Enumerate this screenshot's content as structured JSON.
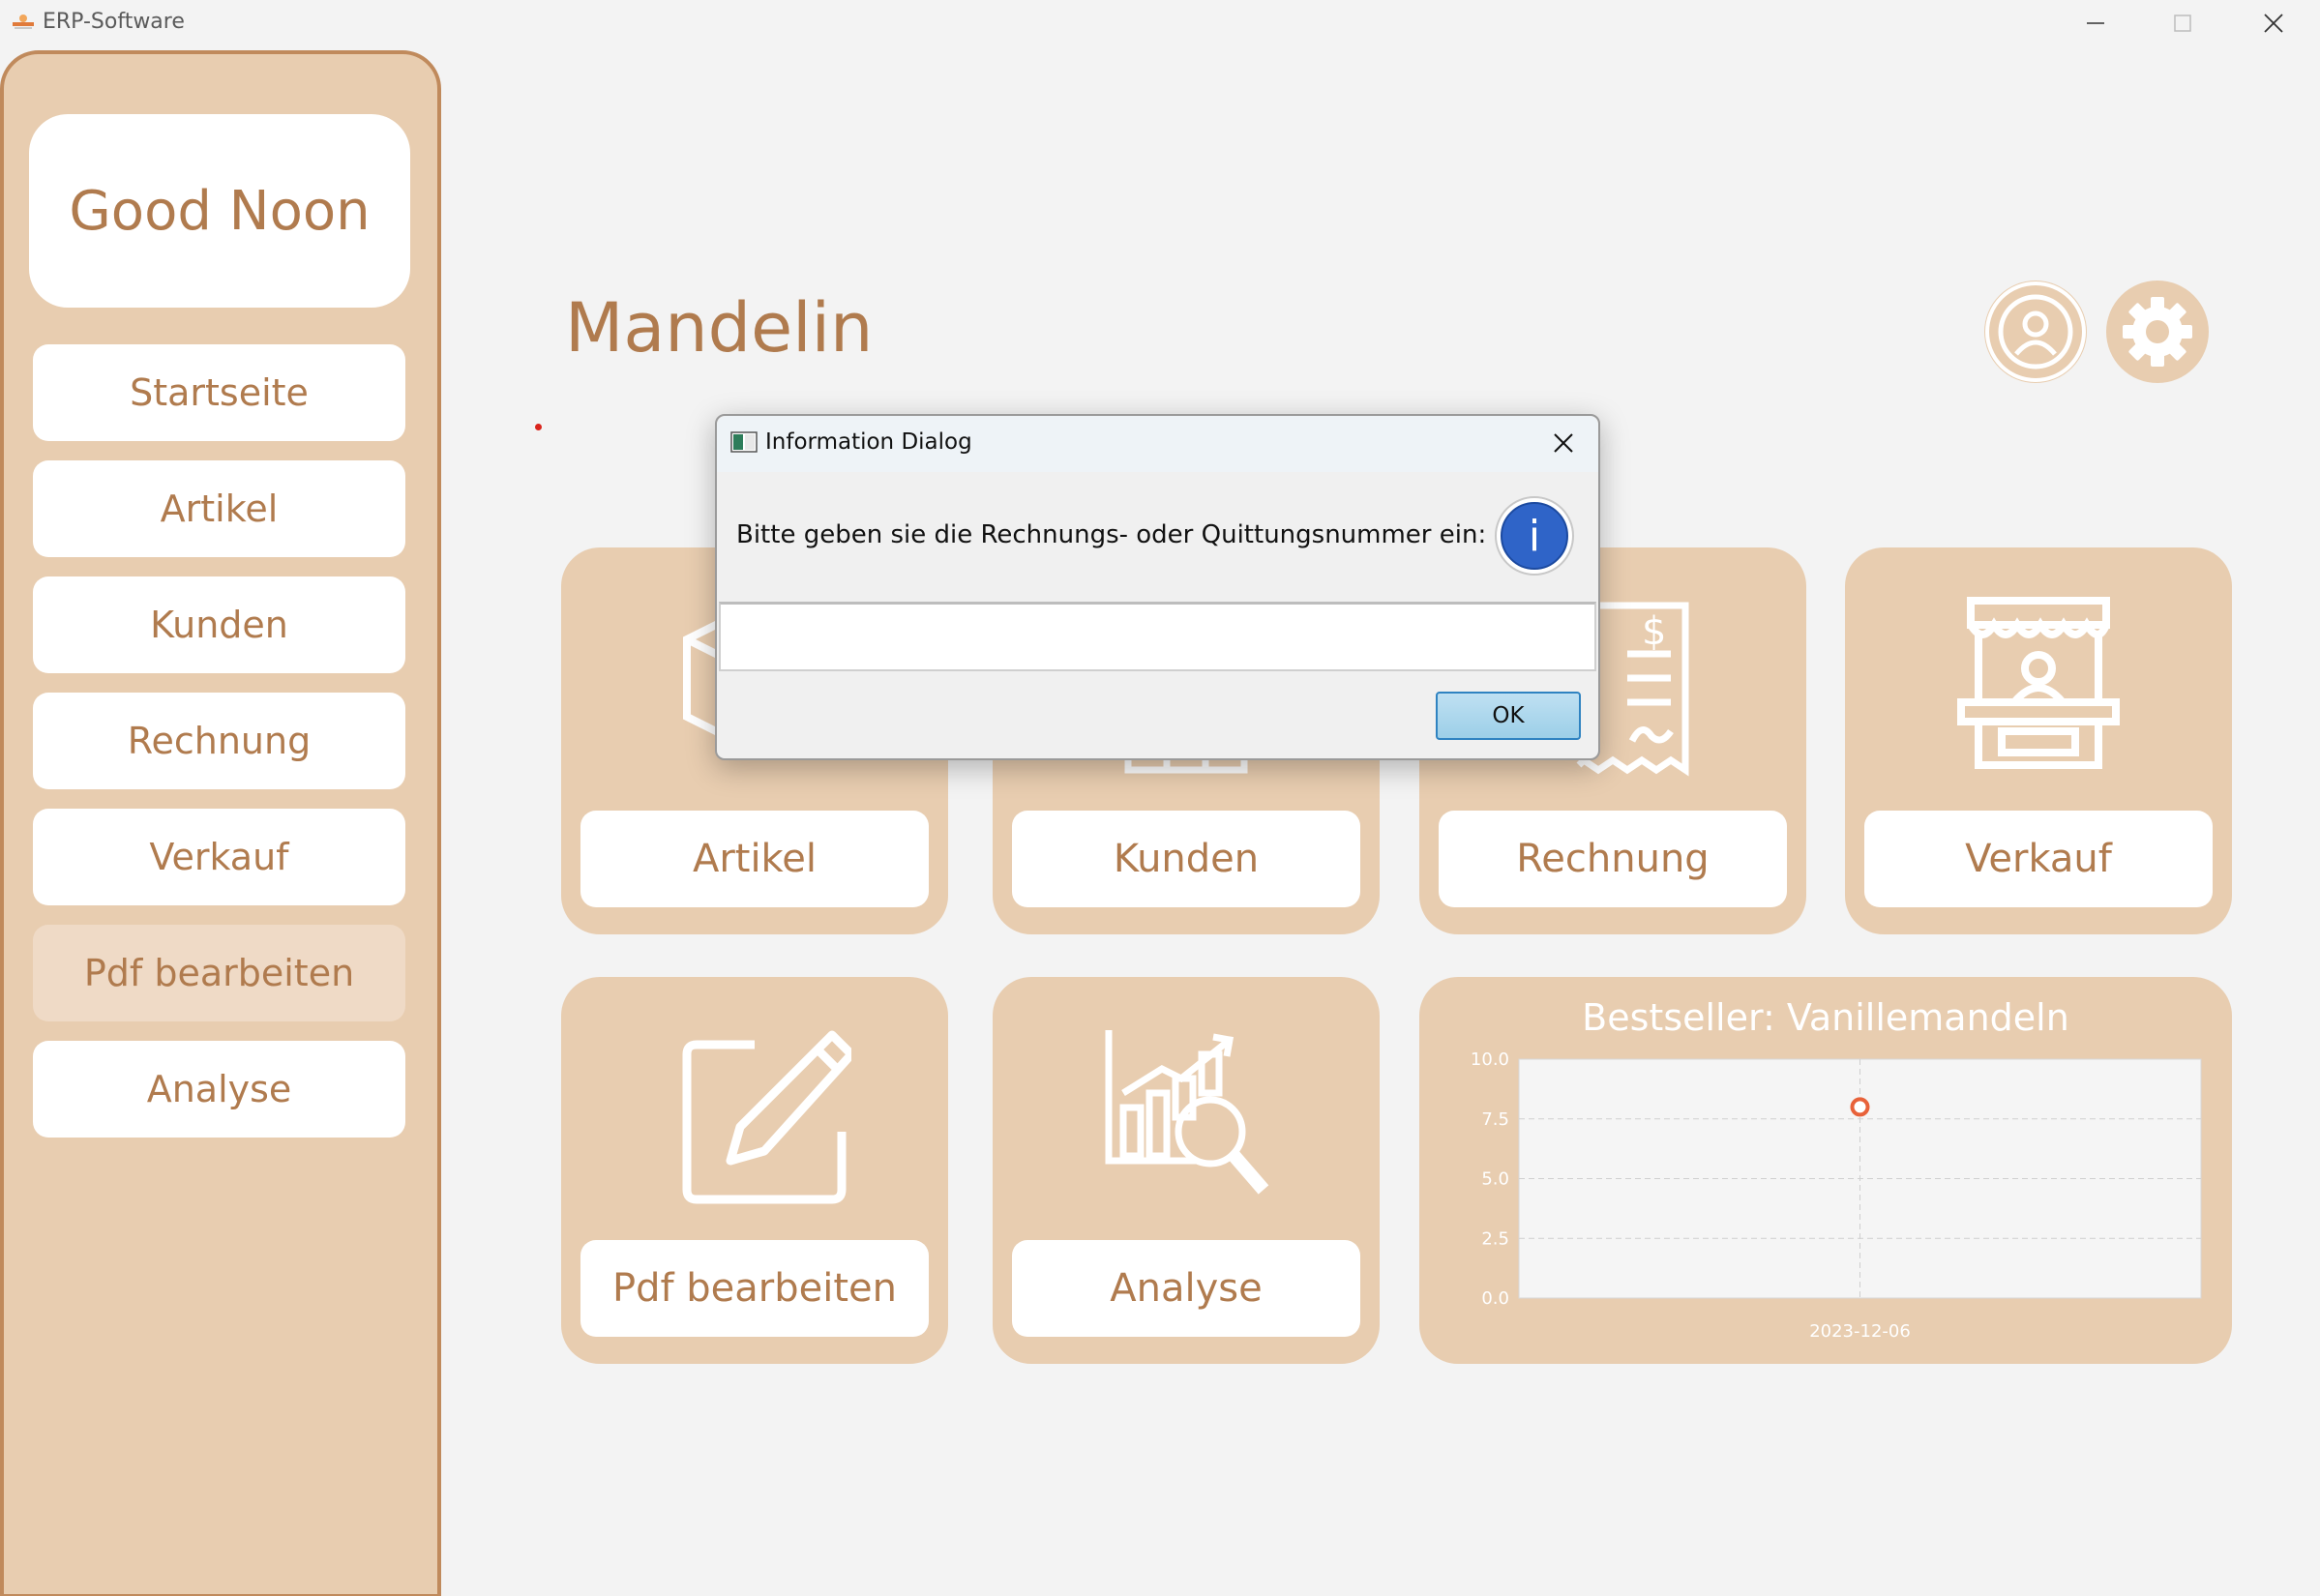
{
  "window": {
    "title": "ERP-Software"
  },
  "sidebar": {
    "greeting": "Good Noon",
    "items": [
      {
        "label": "Startseite"
      },
      {
        "label": "Artikel"
      },
      {
        "label": "Kunden"
      },
      {
        "label": "Rechnung"
      },
      {
        "label": "Verkauf"
      },
      {
        "label": "Pdf bearbeiten",
        "active": true
      },
      {
        "label": "Analyse"
      }
    ]
  },
  "main": {
    "title": "Mandelin",
    "tiles": [
      {
        "label": "Artikel",
        "icon": "box-icon"
      },
      {
        "label": "Kunden",
        "icon": "customers-icon"
      },
      {
        "label": "Rechnung",
        "icon": "invoice-icon"
      },
      {
        "label": "Verkauf",
        "icon": "shop-icon"
      },
      {
        "label": "Pdf bearbeiten",
        "icon": "edit-icon"
      },
      {
        "label": "Analyse",
        "icon": "analysis-icon"
      }
    ]
  },
  "chart_data": {
    "type": "scatter",
    "title": "Bestseller: Vanillemandeln",
    "x": [
      "2023-12-06"
    ],
    "y": [
      8.0
    ],
    "yticks": [
      "0.0",
      "2.5",
      "5.0",
      "7.5",
      "10.0"
    ],
    "ylim": [
      0,
      10
    ],
    "grid": true
  },
  "dialog": {
    "title": "Information Dialog",
    "message": "Bitte geben sie die Rechnungs- oder Quittungsnummer ein:",
    "input_value": "",
    "ok_label": "OK"
  },
  "colors": {
    "accent": "#b07b4e",
    "tile_bg": "#e8cdb0",
    "point": "#e8623a"
  }
}
